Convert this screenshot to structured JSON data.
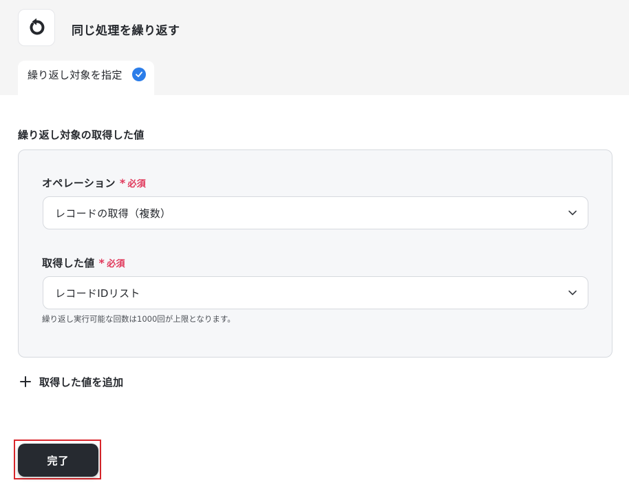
{
  "header": {
    "app_icon": "refresh-loop-icon",
    "title": "同じ処理を繰り返す"
  },
  "tab": {
    "label": "繰り返し対象を指定",
    "icon": "check-circle-icon",
    "accent": "#2b7de9"
  },
  "section": {
    "title": "繰り返し対象の取得した値"
  },
  "fields": [
    {
      "label": "オペレーション",
      "required_mark": "*",
      "required_label": "必須",
      "value": "レコードの取得（複数）"
    },
    {
      "label": "取得した値",
      "required_mark": "*",
      "required_label": "必須",
      "value": "レコードIDリスト",
      "helper": "繰り返し実行可能な回数は1000回が上限となります。"
    }
  ],
  "add_value": {
    "label": "取得した値を追加",
    "icon": "plus-icon"
  },
  "footer": {
    "done_label": "完了"
  },
  "colors": {
    "required": "#e0375a",
    "button_bg": "#262a30",
    "highlight": "#d9262b"
  }
}
